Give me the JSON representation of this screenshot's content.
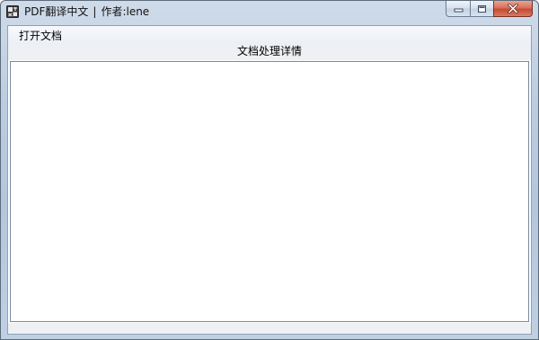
{
  "window": {
    "title_app": "PDF翻译中文",
    "title_sep": "|",
    "title_author": "作者:lene",
    "icon": "app-icon"
  },
  "controls": {
    "minimize_icon": "minimize-icon",
    "maximize_icon": "maximize-icon",
    "close_icon": "close-icon"
  },
  "menu": {
    "open_label": "打开文档"
  },
  "main": {
    "section_title": "文档处理详情",
    "details_text": ""
  },
  "colors": {
    "frame": "#bccde1",
    "close": "#c44b34"
  }
}
